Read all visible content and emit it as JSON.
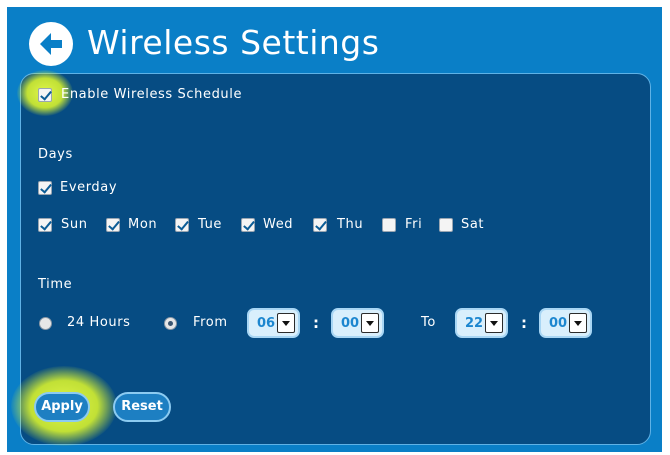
{
  "header": {
    "title": "Wireless Settings",
    "back_icon": "arrow-left-circle-icon"
  },
  "schedule": {
    "enable_label": "Enable Wireless Schedule",
    "enabled": true
  },
  "days": {
    "heading": "Days",
    "everyday_label": "Everday",
    "everyday_checked": true,
    "items": [
      {
        "label": "Sun",
        "checked": true
      },
      {
        "label": "Mon",
        "checked": true
      },
      {
        "label": "Tue",
        "checked": true
      },
      {
        "label": "Wed",
        "checked": true
      },
      {
        "label": "Thu",
        "checked": true
      },
      {
        "label": "Fri",
        "checked": false
      },
      {
        "label": "Sat",
        "checked": false
      }
    ]
  },
  "time": {
    "heading": "Time",
    "hours24_label": "24 Hours",
    "hours24_selected": false,
    "from_label": "From",
    "from_selected": true,
    "from_hour": "06",
    "from_minute": "00",
    "to_label": "To",
    "to_hour": "22",
    "to_minute": "00",
    "separator": ":"
  },
  "actions": {
    "apply_label": "Apply",
    "reset_label": "Reset"
  },
  "colors": {
    "frame": "#0a7fc7",
    "panel": "#064c83",
    "highlight": "#e6fb2e"
  }
}
